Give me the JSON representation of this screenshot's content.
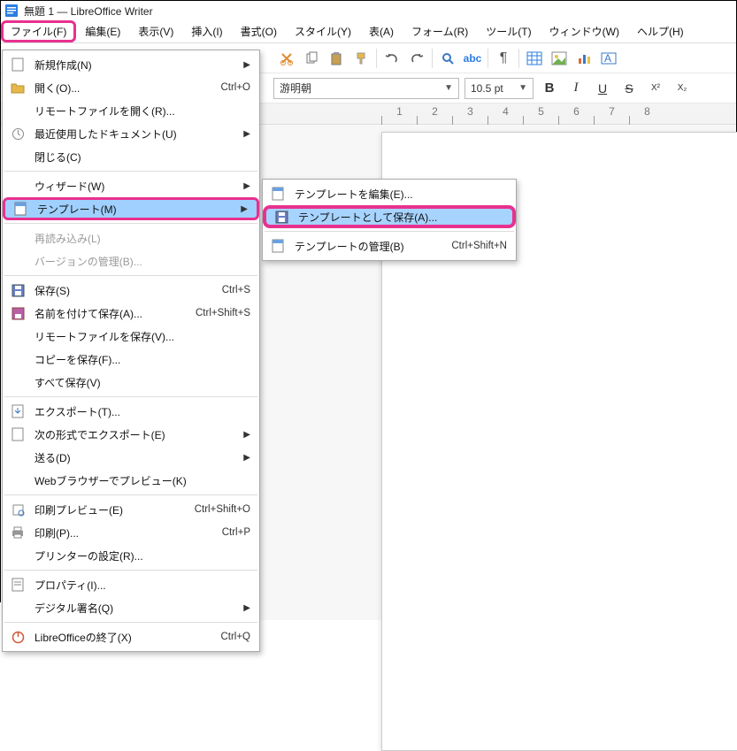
{
  "title": "無題 1 — LibreOffice Writer",
  "menubar": {
    "file": "ファイル(F)",
    "edit": "編集(E)",
    "view": "表示(V)",
    "insert": "挿入(I)",
    "format": "書式(O)",
    "style": "スタイル(Y)",
    "table": "表(A)",
    "form": "フォーム(R)",
    "tools": "ツール(T)",
    "window": "ウィンドウ(W)",
    "help": "ヘルプ(H)"
  },
  "toolbar2": {
    "font_name": "游明朝",
    "font_size": "10.5 pt",
    "b": "B",
    "i": "I",
    "u": "U",
    "s": "S",
    "sup": "X²",
    "sub": "X₂"
  },
  "file_menu": {
    "new": "新規作成(N)",
    "open": "開く(O)...",
    "open_sc": "Ctrl+O",
    "remote_open": "リモートファイルを開く(R)...",
    "recent": "最近使用したドキュメント(U)",
    "close": "閉じる(C)",
    "wizard": "ウィザード(W)",
    "templates": "テンプレート(M)",
    "reload": "再読み込み(L)",
    "versions": "バージョンの管理(B)...",
    "save": "保存(S)",
    "save_sc": "Ctrl+S",
    "save_as": "名前を付けて保存(A)...",
    "save_as_sc": "Ctrl+Shift+S",
    "remote_save": "リモートファイルを保存(V)...",
    "save_copy": "コピーを保存(F)...",
    "save_all": "すべて保存(V)",
    "export": "エクスポート(T)...",
    "export_as": "次の形式でエクスポート(E)",
    "send": "送る(D)",
    "web_preview": "Webブラウザーでプレビュー(K)",
    "print_preview": "印刷プレビュー(E)",
    "print_preview_sc": "Ctrl+Shift+O",
    "print": "印刷(P)...",
    "print_sc": "Ctrl+P",
    "printer_settings": "プリンターの設定(R)...",
    "properties": "プロパティ(I)...",
    "digital_sig": "デジタル署名(Q)",
    "exit": "LibreOfficeの終了(X)",
    "exit_sc": "Ctrl+Q"
  },
  "sub_menu": {
    "edit_template": "テンプレートを編集(E)...",
    "save_as_template": "テンプレートとして保存(A)...",
    "manage_templates": "テンプレートの管理(B)",
    "manage_sc": "Ctrl+Shift+N"
  },
  "ruler": {
    "t1": "1",
    "t2": "2",
    "t3": "3",
    "t4": "4",
    "t5": "5",
    "t6": "6",
    "t7": "7",
    "t8": "8"
  }
}
